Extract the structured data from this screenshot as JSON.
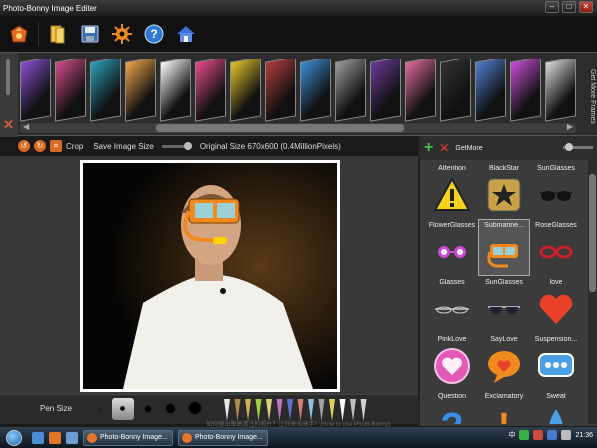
{
  "window": {
    "title": "Photo-Bonny Image Editer",
    "buttons": [
      "–",
      "□",
      "✕"
    ]
  },
  "toolbar": {
    "items": [
      "open-icon",
      "folder-icon",
      "save-icon",
      "settings-icon",
      "help-icon",
      "home-icon"
    ]
  },
  "frames": {
    "more_label": "Get More Frames",
    "colors": [
      "#8a4fd6",
      "#d34b8a",
      "#2aa0b8",
      "#f0a64a",
      "#ffffff",
      "#e84a8c",
      "#e3c62a",
      "#b43d3d",
      "#3c8fd6",
      "#9b9b9b",
      "#6a3a9a",
      "#e06b9f",
      "#333333",
      "#4f7fd0",
      "#c94fd6",
      "#d9d9d9",
      "#f2c4dc",
      "#e6e6e6",
      "#8b5ad1",
      "#a6d13e",
      "#2d86d1",
      "#e05c3c",
      "#aaaaaa",
      "#c23e9a",
      "#3ad16b",
      "#999999"
    ]
  },
  "edit": {
    "crop": "Crop",
    "save_size": "Save Image Size",
    "original_size": "Original Size 670x600 (0.4MillionPixels)"
  },
  "pen": {
    "label": "Pen Size"
  },
  "hint": "如何做出像高清注的照片？让你来当高手！(How to use Photo-Bonny)",
  "stickers": {
    "get_more": "GetMore",
    "items": [
      {
        "label": "Attention",
        "icon": "warning-sign-icon"
      },
      {
        "label": "BlackStar",
        "icon": "black-star-icon"
      },
      {
        "label": "SunGlasses",
        "icon": "sunglasses-icon"
      },
      {
        "label": "FlowerGlasses",
        "icon": "flower-glasses-icon"
      },
      {
        "label": "Submarine...",
        "icon": "submarine-goggles-icon"
      },
      {
        "label": "RoseGlasses",
        "icon": "rose-glasses-icon"
      },
      {
        "label": "Glasses",
        "icon": "glasses-icon"
      },
      {
        "label": "SunGlasses",
        "icon": "sunglasses2-icon"
      },
      {
        "label": "love",
        "icon": "heart-icon"
      },
      {
        "label": "PinkLove",
        "icon": "pink-heart-icon"
      },
      {
        "label": "SayLove",
        "icon": "say-love-bubble-icon"
      },
      {
        "label": "Suspension...",
        "icon": "suspension-bubble-icon"
      },
      {
        "label": "Question",
        "icon": "question-mark-icon"
      },
      {
        "label": "Exclamatory",
        "icon": "exclamation-mark-icon"
      },
      {
        "label": "Sweat",
        "icon": "sweat-drop-icon"
      }
    ],
    "selected_index": 4
  },
  "taskbar": {
    "tasks": [
      "Photo-Bonny Image...",
      "Photo-Bonny Image..."
    ],
    "tray_text": "中",
    "clock": "21:36"
  }
}
